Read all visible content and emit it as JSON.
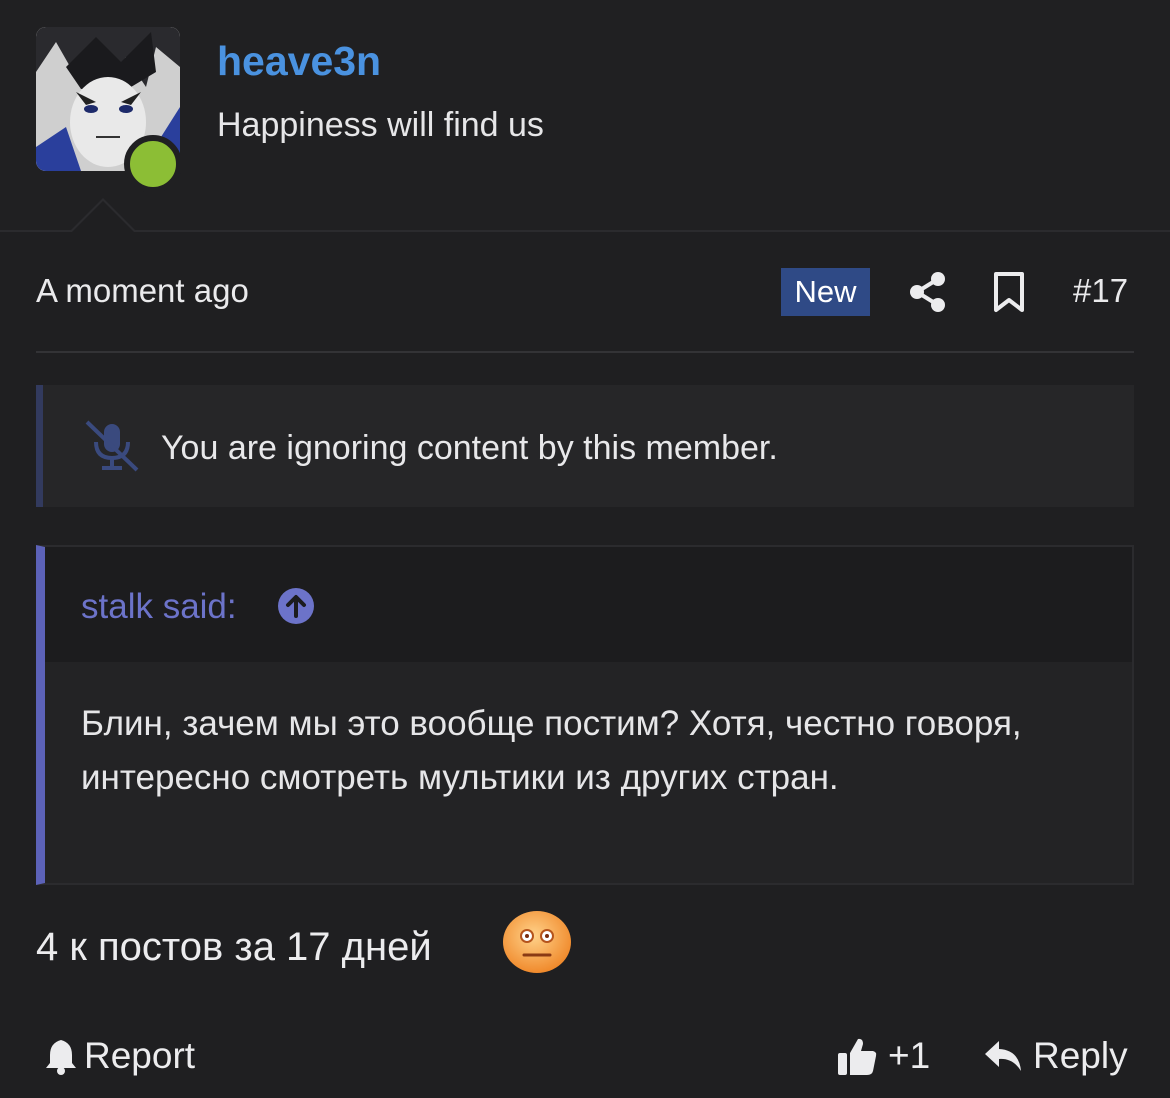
{
  "user": {
    "name": "heave3n",
    "title": "Happiness will find us",
    "online_color": "#8cbe35",
    "name_color": "#4a92e0"
  },
  "meta": {
    "time": "A moment ago",
    "badge": "New",
    "badge_color": "#2f4a86",
    "post_number": "#17",
    "icons": [
      "share-icon",
      "bookmark-icon"
    ]
  },
  "ignore_notice": {
    "icon": "microphone-slash-icon",
    "text": "You are ignoring content by this member."
  },
  "quote": {
    "author_line": "stalk said:",
    "author_color": "#6c73c9",
    "icon": "arrow-up-circle-icon",
    "body": "Блин, зачем мы это вообще постим? Хотя, честно говоря, интересно смотреть мультики из других стран."
  },
  "message": {
    "text": "4 к постов за 17 дней",
    "emoji": "flat-face-emoji"
  },
  "actions": {
    "report_label": "Report",
    "like_label": "+1",
    "reply_label": "Reply"
  }
}
